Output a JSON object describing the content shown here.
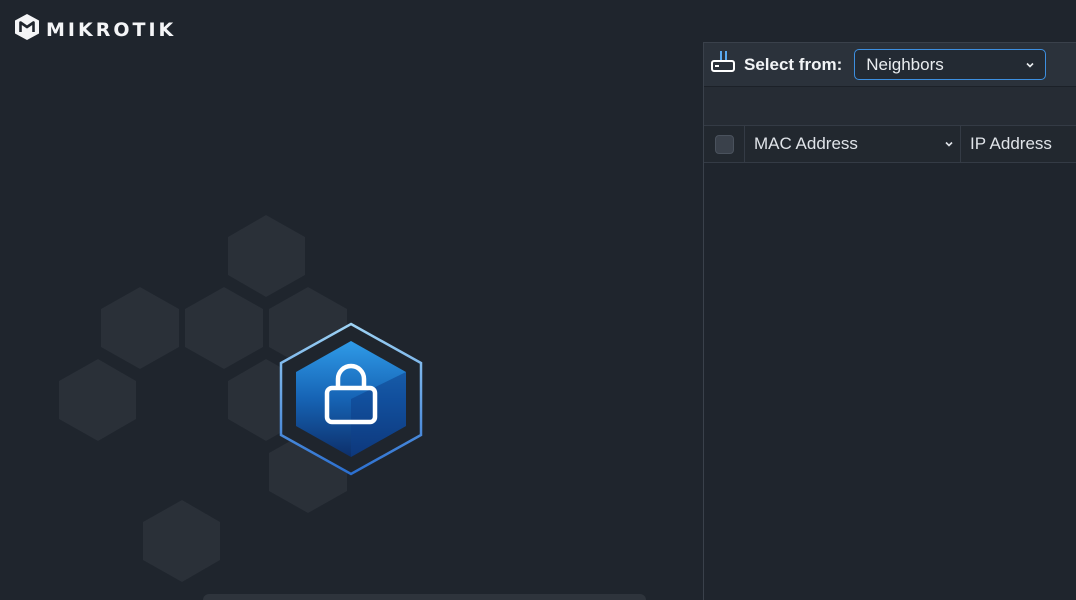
{
  "brand": {
    "name": "MIKROTIK"
  },
  "panel": {
    "select_from_label": "Select from:",
    "select_value": "Neighbors",
    "columns": {
      "mac": "MAC Address",
      "ip": "IP Address"
    }
  },
  "icons": {
    "brand_logo": "mikrotik-logo-icon",
    "router": "router-icon",
    "lock": "lock-icon",
    "dropdown": "chevron-down-icon"
  },
  "colors": {
    "background": "#1f252d",
    "accent": "#3d8fe0",
    "lock_hex": "#1e78c8"
  }
}
